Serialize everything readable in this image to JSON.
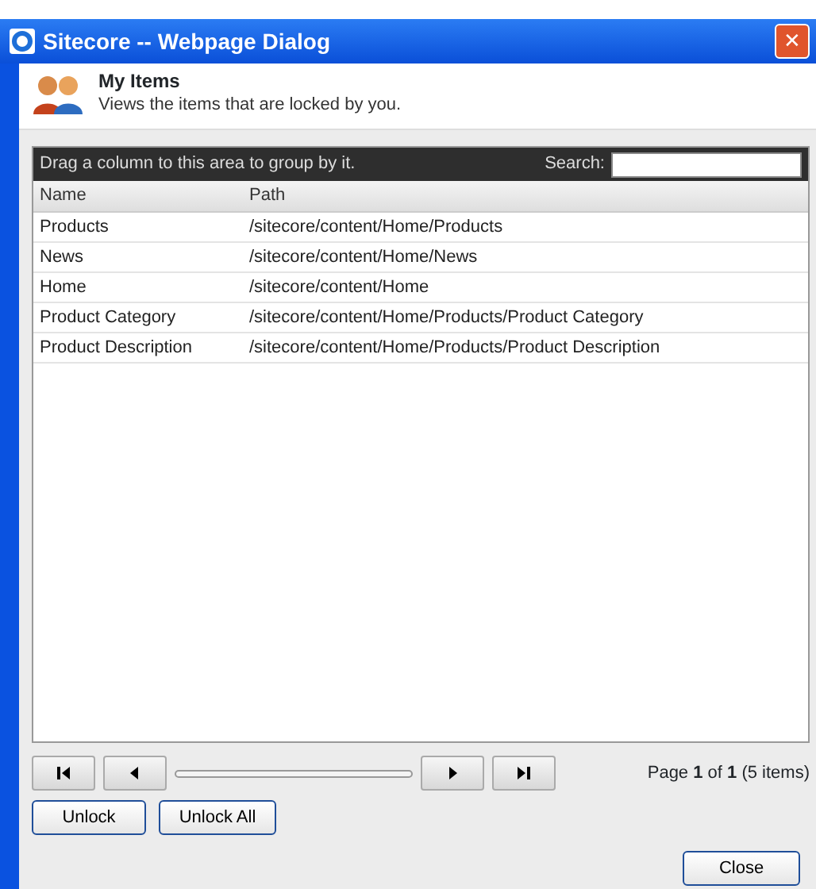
{
  "window": {
    "title": "Sitecore -- Webpage Dialog",
    "close": "✕"
  },
  "header": {
    "title": "My Items",
    "subtitle": "Views the items that are locked by you."
  },
  "grid": {
    "group_hint": "Drag a column to this area to group by it.",
    "search_label": "Search:",
    "columns": [
      "Name",
      "Path"
    ],
    "rows": [
      {
        "name": "Products",
        "path": "/sitecore/content/Home/Products"
      },
      {
        "name": "News",
        "path": "/sitecore/content/Home/News"
      },
      {
        "name": "Home",
        "path": "/sitecore/content/Home"
      },
      {
        "name": "Product Category",
        "path": "/sitecore/content/Home/Products/Product Category"
      },
      {
        "name": "Product Description",
        "path": "/sitecore/content/Home/Products/Product Description"
      }
    ],
    "pager": {
      "summary": "Page **1** of **1** (5 items)"
    }
  },
  "buttons": [
    "Unlock",
    "Unlock All"
  ],
  "close_button": "Close"
}
